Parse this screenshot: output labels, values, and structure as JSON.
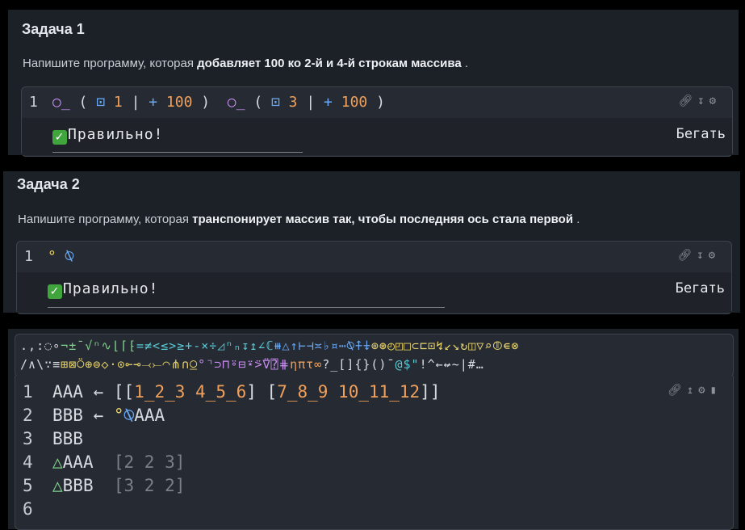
{
  "task1": {
    "title": "Задача 1",
    "desc_plain": "Напишите программу, которая ",
    "desc_bold": "добавляет 100 ко 2-й и 4-й строкам массива",
    "desc_end": " .",
    "line_no": "1",
    "code_tokens": [
      {
        "t": "○̲",
        "c": "pur"
      },
      {
        "t": " ( ",
        "c": "wht"
      },
      {
        "t": "⊡",
        "c": "blu"
      },
      {
        "t": " 1 ",
        "c": "ora"
      },
      {
        "t": "| ",
        "c": "wht"
      },
      {
        "t": "+",
        "c": "blu"
      },
      {
        "t": " 100 ",
        "c": "ora"
      },
      {
        "t": ")  ",
        "c": "wht"
      },
      {
        "t": "○̲",
        "c": "pur"
      },
      {
        "t": " ( ",
        "c": "wht"
      },
      {
        "t": "⊡",
        "c": "blu"
      },
      {
        "t": " 3 ",
        "c": "ora"
      },
      {
        "t": "| ",
        "c": "wht"
      },
      {
        "t": "+",
        "c": "blu"
      },
      {
        "t": " 100 ",
        "c": "ora"
      },
      {
        "t": ")",
        "c": "wht"
      }
    ],
    "result": "Правильно!",
    "run_label": "Бегать",
    "tool_icons": [
      "link-icon",
      "download-icon",
      "gear-icon"
    ]
  },
  "task2": {
    "title": "Задача 2",
    "desc_plain": "Напишите программу, которая ",
    "desc_bold": "транспонирует массив так, чтобы последняя ось стала первой",
    "desc_end": " .",
    "line_no": "1",
    "code_tokens": [
      {
        "t": "°",
        "c": "yel"
      },
      {
        "t": " ⍉",
        "c": "blu"
      }
    ],
    "result": "Правильно!",
    "run_label": "Бегать"
  },
  "palette": {
    "row1": [
      {
        "t": ".",
        "c": "wht"
      },
      {
        "t": ",",
        "c": "wht"
      },
      {
        "t": ":",
        "c": "wht"
      },
      {
        "t": "◌",
        "c": "wht"
      },
      {
        "t": "∘",
        "c": "wht"
      },
      {
        "t": "¬",
        "c": "grn"
      },
      {
        "t": "±",
        "c": "grn"
      },
      {
        "t": "¯",
        "c": "grn"
      },
      {
        "t": "√",
        "c": "grn"
      },
      {
        "t": "ⁿ",
        "c": "grn"
      },
      {
        "t": "∿",
        "c": "grn"
      },
      {
        "t": "⌊",
        "c": "grn"
      },
      {
        "t": "⌈",
        "c": "grn"
      },
      {
        "t": "⁅",
        "c": "grn"
      },
      {
        "t": "=",
        "c": "cya"
      },
      {
        "t": "≠",
        "c": "cya"
      },
      {
        "t": "<",
        "c": "cya"
      },
      {
        "t": "≤",
        "c": "cya"
      },
      {
        "t": ">",
        "c": "cya"
      },
      {
        "t": "≥",
        "c": "cya"
      },
      {
        "t": "+",
        "c": "cya"
      },
      {
        "t": "-",
        "c": "cya"
      },
      {
        "t": "×",
        "c": "cya"
      },
      {
        "t": "÷",
        "c": "cya"
      },
      {
        "t": "◿",
        "c": "cya"
      },
      {
        "t": "ⁿ",
        "c": "cya"
      },
      {
        "t": "ₙ",
        "c": "cya"
      },
      {
        "t": "↧",
        "c": "cya"
      },
      {
        "t": "↥",
        "c": "cya"
      },
      {
        "t": "∠",
        "c": "cya"
      },
      {
        "t": "ℂ",
        "c": "cya"
      },
      {
        "t": "⧻",
        "c": "blu"
      },
      {
        "t": "△",
        "c": "blu"
      },
      {
        "t": "↑",
        "c": "blu"
      },
      {
        "t": "⊢",
        "c": "blu"
      },
      {
        "t": "⊣",
        "c": "blu"
      },
      {
        "t": "≍",
        "c": "blu"
      },
      {
        "t": "♭",
        "c": "blu"
      },
      {
        "t": "¤",
        "c": "blu"
      },
      {
        "t": "⋯",
        "c": "blu"
      },
      {
        "t": "⍉",
        "c": "blu"
      },
      {
        "t": "⍏",
        "c": "blu"
      },
      {
        "t": "⍖",
        "c": "blu"
      },
      {
        "t": "⊚",
        "c": "yel"
      },
      {
        "t": "⊛",
        "c": "yel"
      },
      {
        "t": "◴",
        "c": "yel"
      },
      {
        "t": "◰",
        "c": "yel"
      },
      {
        "t": "□",
        "c": "yel"
      },
      {
        "t": "⊂",
        "c": "yel"
      },
      {
        "t": "⊏",
        "c": "yel"
      },
      {
        "t": "⊡",
        "c": "yel"
      },
      {
        "t": "↯",
        "c": "yel"
      },
      {
        "t": "↙",
        "c": "yel"
      },
      {
        "t": "↘",
        "c": "yel"
      },
      {
        "t": "↻",
        "c": "yel"
      },
      {
        "t": "◫",
        "c": "yel"
      },
      {
        "t": "▽",
        "c": "yel"
      },
      {
        "t": "⌕",
        "c": "yel"
      },
      {
        "t": "⦷",
        "c": "yel"
      },
      {
        "t": "∊",
        "c": "yel"
      },
      {
        "t": "⊗",
        "c": "yel"
      }
    ],
    "row2": [
      {
        "t": "/",
        "c": "wht"
      },
      {
        "t": "∧",
        "c": "wht"
      },
      {
        "t": "\\",
        "c": "wht"
      },
      {
        "t": "∵",
        "c": "wht"
      },
      {
        "t": "≡",
        "c": "wht"
      },
      {
        "t": "⊞",
        "c": "yel"
      },
      {
        "t": "⊠",
        "c": "yel"
      },
      {
        "t": "⍥",
        "c": "yel"
      },
      {
        "t": "⊕",
        "c": "yel"
      },
      {
        "t": "⊜",
        "c": "yel"
      },
      {
        "t": "◇",
        "c": "yel"
      },
      {
        "t": "⋅",
        "c": "yel"
      },
      {
        "t": "⊙",
        "c": "yel"
      },
      {
        "t": "⟜",
        "c": "yel"
      },
      {
        "t": "⊸",
        "c": "yel"
      },
      {
        "t": "⤙",
        "c": "yel"
      },
      {
        "t": "⤚",
        "c": "yel"
      },
      {
        "t": "◠",
        "c": "yel"
      },
      {
        "t": "⋔",
        "c": "yel"
      },
      {
        "t": "∩",
        "c": "yel"
      },
      {
        "t": "⍜",
        "c": "yel"
      },
      {
        "t": "°",
        "c": "pur"
      },
      {
        "t": "⌝",
        "c": "pur"
      },
      {
        "t": "⊃",
        "c": "pur"
      },
      {
        "t": "⊓",
        "c": "pur"
      },
      {
        "t": "⍤",
        "c": "pur"
      },
      {
        "t": "⊟",
        "c": "pur"
      },
      {
        "t": "⍣",
        "c": "pur"
      },
      {
        "t": "⍩",
        "c": "pur"
      },
      {
        "t": "⍢",
        "c": "pur"
      },
      {
        "t": "⍰",
        "c": "pur"
      },
      {
        "t": "⋕",
        "c": "pur"
      },
      {
        "t": "η",
        "c": "ora"
      },
      {
        "t": "π",
        "c": "ora"
      },
      {
        "t": "τ",
        "c": "ora"
      },
      {
        "t": "∞",
        "c": "ora"
      },
      {
        "t": "?",
        "c": "wht"
      },
      {
        "t": "_",
        "c": "wht"
      },
      {
        "t": "[",
        "c": "wht"
      },
      {
        "t": "]",
        "c": "wht"
      },
      {
        "t": "{",
        "c": "wht"
      },
      {
        "t": "}",
        "c": "wht"
      },
      {
        "t": "(",
        "c": "wht"
      },
      {
        "t": ")",
        "c": "wht"
      },
      {
        "t": "¯",
        "c": "wht"
      },
      {
        "t": "@",
        "c": "cya"
      },
      {
        "t": "$",
        "c": "cya"
      },
      {
        "t": "\"",
        "c": "cya"
      },
      {
        "t": "!",
        "c": "wht"
      },
      {
        "t": "^",
        "c": "wht"
      },
      {
        "t": "←",
        "c": "wht"
      },
      {
        "t": "↚",
        "c": "wht"
      },
      {
        "t": "~",
        "c": "wht"
      },
      {
        "t": "|",
        "c": "wht"
      },
      {
        "t": "#",
        "c": "wht"
      },
      {
        "t": "…",
        "c": "wht"
      }
    ]
  },
  "playground": {
    "lines": [
      {
        "n": "1",
        "tokens": [
          {
            "t": "AAA ",
            "c": "wht"
          },
          {
            "t": "← ",
            "c": "wht"
          },
          {
            "t": "[[",
            "c": "wht"
          },
          {
            "t": "1_2_3 4_5_6",
            "c": "ora"
          },
          {
            "t": "] [",
            "c": "wht"
          },
          {
            "t": "7_8_9 10_11_12",
            "c": "ora"
          },
          {
            "t": "]]",
            "c": "wht"
          }
        ]
      },
      {
        "n": "2",
        "tokens": [
          {
            "t": "BBB ",
            "c": "wht"
          },
          {
            "t": "← ",
            "c": "wht"
          },
          {
            "t": "°",
            "c": "yel"
          },
          {
            "t": "⍉",
            "c": "blu"
          },
          {
            "t": "AAA",
            "c": "wht"
          }
        ]
      },
      {
        "n": "3",
        "tokens": [
          {
            "t": "BBB",
            "c": "wht"
          }
        ]
      },
      {
        "n": "4",
        "tokens": [
          {
            "t": "△",
            "c": "grn"
          },
          {
            "t": "AAA  ",
            "c": "wht"
          },
          {
            "t": "[2 2 3]",
            "c": "gry"
          }
        ]
      },
      {
        "n": "5",
        "tokens": [
          {
            "t": "△",
            "c": "grn"
          },
          {
            "t": "BBB  ",
            "c": "wht"
          },
          {
            "t": "[3 2 2]",
            "c": "gry"
          }
        ]
      },
      {
        "n": "6",
        "tokens": []
      }
    ]
  }
}
